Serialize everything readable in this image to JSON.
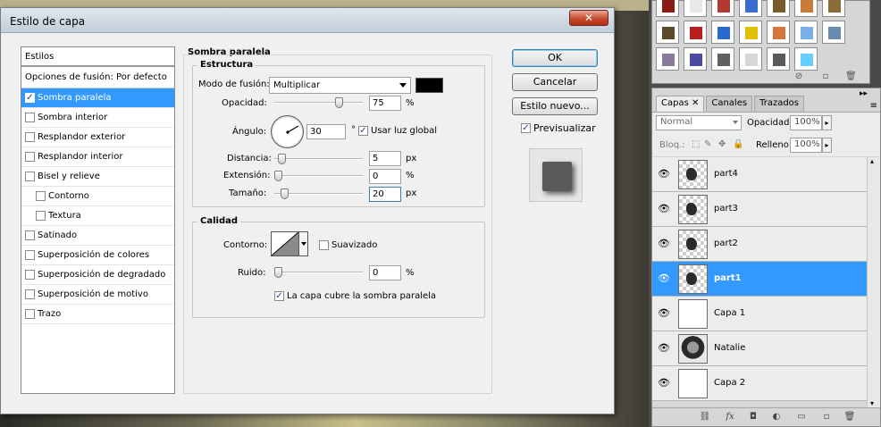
{
  "dialog": {
    "title": "Estilo de capa",
    "close_label": "✕",
    "styles_header": "Estilos",
    "blend_options": "Opciones de fusión: Por defecto",
    "styles": [
      {
        "label": "Sombra paralela",
        "checked": true,
        "selected": true,
        "indent": false
      },
      {
        "label": "Sombra interior",
        "checked": false,
        "selected": false,
        "indent": false
      },
      {
        "label": "Resplandor exterior",
        "checked": false,
        "selected": false,
        "indent": false
      },
      {
        "label": "Resplandor interior",
        "checked": false,
        "selected": false,
        "indent": false
      },
      {
        "label": "Bisel y relieve",
        "checked": false,
        "selected": false,
        "indent": false
      },
      {
        "label": "Contorno",
        "checked": false,
        "selected": false,
        "indent": true
      },
      {
        "label": "Textura",
        "checked": false,
        "selected": false,
        "indent": true
      },
      {
        "label": "Satinado",
        "checked": false,
        "selected": false,
        "indent": false
      },
      {
        "label": "Superposición de colores",
        "checked": false,
        "selected": false,
        "indent": false
      },
      {
        "label": "Superposición de degradado",
        "checked": false,
        "selected": false,
        "indent": false
      },
      {
        "label": "Superposición de motivo",
        "checked": false,
        "selected": false,
        "indent": false
      },
      {
        "label": "Trazo",
        "checked": false,
        "selected": false,
        "indent": false
      }
    ],
    "section_title": "Sombra paralela",
    "structure": {
      "title": "Estructura",
      "blend_mode_label": "Modo de fusión:",
      "blend_mode_value": "Multiplicar",
      "color": "#000000",
      "opacity_label": "Opacidad:",
      "opacity_value": "75",
      "opacity_unit": "%",
      "opacity_level": 0.75,
      "angle_label": "Ángulo:",
      "angle_value": "30",
      "angle_unit": "°",
      "global_light_label": "Usar luz global",
      "global_light_checked": true,
      "distance_label": "Distancia:",
      "distance_value": "5",
      "distance_unit": "px",
      "distance_level": 0.04,
      "spread_label": "Extensión:",
      "spread_value": "0",
      "spread_unit": "%",
      "spread_level": 0.0,
      "size_label": "Tamaño:",
      "size_value": "20",
      "size_unit": "px",
      "size_level": 0.08
    },
    "quality": {
      "title": "Calidad",
      "contour_label": "Contorno:",
      "antialias_label": "Suavizado",
      "antialias_checked": false,
      "noise_label": "Ruido:",
      "noise_value": "0",
      "noise_unit": "%",
      "noise_level": 0.0
    },
    "knockout_label": "La capa cubre la sombra paralela",
    "knockout_checked": true,
    "buttons": {
      "ok": "OK",
      "cancel": "Cancelar",
      "new_style": "Estilo nuevo...",
      "preview_label": "Previsualizar",
      "preview_checked": true
    }
  },
  "layers_panel": {
    "tabs": [
      "Capas",
      "Canales",
      "Trazados"
    ],
    "blend_mode": "Normal",
    "opacity_label": "Opacidad:",
    "opacity_value": "100%",
    "lock_label": "Bloq.:",
    "fill_label": "Relleno:",
    "fill_value": "100%",
    "layers": [
      {
        "name": "part4",
        "selected": false,
        "thumb": "checker"
      },
      {
        "name": "part3",
        "selected": false,
        "thumb": "checker"
      },
      {
        "name": "part2",
        "selected": false,
        "thumb": "checker"
      },
      {
        "name": "part1",
        "selected": true,
        "thumb": "checker"
      },
      {
        "name": "Capa 1",
        "selected": false,
        "thumb": "white"
      },
      {
        "name": "Natalie",
        "selected": false,
        "thumb": "photo"
      },
      {
        "name": "Capa 2",
        "selected": false,
        "thumb": "white"
      }
    ]
  },
  "styles_swatches": {
    "colors": [
      "#8a1b12",
      "#e8e8e8",
      "#b23b2f",
      "#3a6ccd",
      "#7a5a2a",
      "#c77a3a",
      "#8b6d3a",
      "#5a4a2a",
      "#b81e1e",
      "#2a6ad0",
      "#e0c000",
      "#d8763a",
      "#7ab0e8",
      "#6a8bb0",
      "#8a7a9a",
      "#4a4aa0",
      "#606060",
      "#d8d8d8",
      "#5a5a5a",
      "#66cfff"
    ]
  }
}
